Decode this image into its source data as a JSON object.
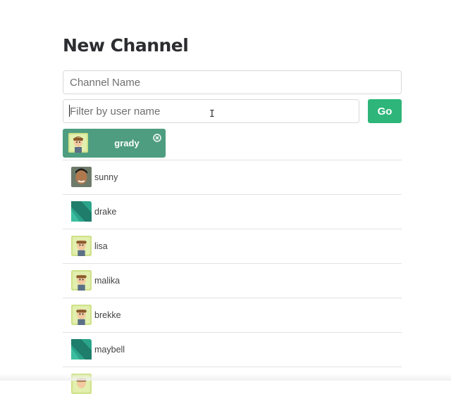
{
  "page": {
    "title": "New Channel"
  },
  "form": {
    "channel_name_placeholder": "Channel Name",
    "filter_placeholder": "Filter by user name",
    "go_label": "Go"
  },
  "selected": [
    {
      "name": "grady",
      "avatar": "cartoon-avatar"
    }
  ],
  "users": [
    {
      "name": "sunny",
      "avatar": "photo-avatar"
    },
    {
      "name": "drake",
      "avatar": "identicon-avatar"
    },
    {
      "name": "lisa",
      "avatar": "cartoon-avatar"
    },
    {
      "name": "malika",
      "avatar": "cartoon-avatar"
    },
    {
      "name": "brekke",
      "avatar": "cartoon-avatar"
    },
    {
      "name": "maybell",
      "avatar": "identicon-avatar"
    },
    {
      "name": "",
      "avatar": "cartoon-avatar"
    }
  ],
  "colors": {
    "accent": "#2eb57a",
    "chip": "#4e9d80",
    "divider": "#e2e2e2"
  }
}
